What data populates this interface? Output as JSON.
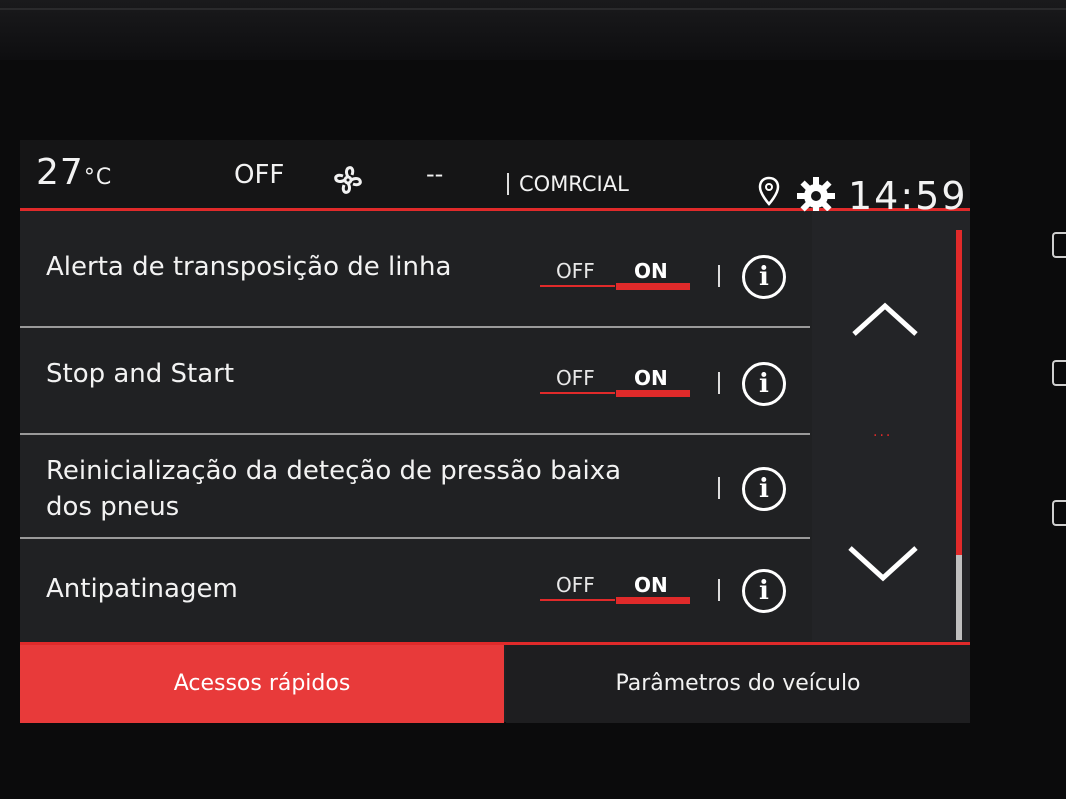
{
  "status_bar": {
    "temperature": "27",
    "temperature_unit": "°C",
    "fan_status": "OFF",
    "fan_icon": "fan-icon",
    "fan_level": "--",
    "radio_station": "COMRCIAL",
    "location_icon": "location-pin-icon",
    "settings_icon": "gear-icon",
    "clock": "14:59"
  },
  "settings": [
    {
      "label": "Alerta de transposição de linha",
      "off_label": "OFF",
      "on_label": "ON",
      "value": "ON",
      "has_toggle": true
    },
    {
      "label": "Stop and Start",
      "off_label": "OFF",
      "on_label": "ON",
      "value": "ON",
      "has_toggle": true
    },
    {
      "label_line1": "Reinicialização da deteção de pressão baixa",
      "label_line2": "dos pneus",
      "has_toggle": false
    },
    {
      "label": "Antipatinagem",
      "off_label": "OFF",
      "on_label": "ON",
      "value": "ON",
      "has_toggle": true
    }
  ],
  "info_icon_glyph": "i",
  "scroll": {
    "up_icon": "chevron-up-icon",
    "down_icon": "chevron-down-icon",
    "page_indicator": "..."
  },
  "tabs": [
    {
      "label": "Acessos rápidos",
      "active": true
    },
    {
      "label": "Parâmetros do veículo",
      "active": false
    }
  ],
  "colors": {
    "accent": "#e02a2a",
    "active_tab": "#e83a3a",
    "background": "#202123",
    "text": "#f2f2f2"
  }
}
